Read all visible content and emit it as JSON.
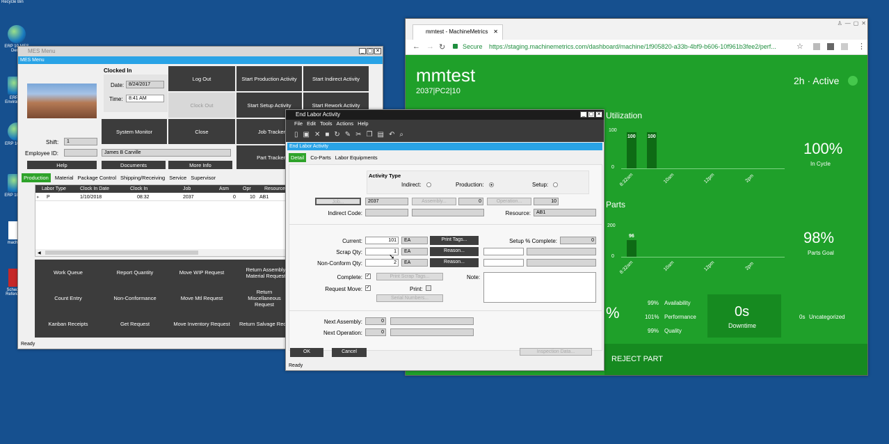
{
  "desktop": {
    "recycle": "Recycle Bin",
    "icon1": "ERP 10 MES Demo",
    "icon2": "ERP 10 Environment",
    "icon3": "ERP 10 EVT",
    "icon4": "ERP 10 MES",
    "icon5": "machine",
    "icon6": "Schedule Reference"
  },
  "mes": {
    "title": "MES Menu",
    "header": "MES Menu",
    "clocked_in": "Clocked In",
    "date_label": "Date:",
    "date": "8/24/2017",
    "time_label": "Time:",
    "time": "8:41 AM",
    "shift_label": "Shift:",
    "shift": "1",
    "emp_label": "Employee ID:",
    "emp_name": "James B Carville",
    "btn": {
      "help": "Help",
      "documents": "Documents",
      "more_info": "More Info",
      "log_out": "Log Out",
      "clock_out": "Clock Out",
      "close": "Close",
      "system_monitor": "System Monitor",
      "start_production": "Start Production Activity",
      "start_indirect": "Start Indirect Activity",
      "start_setup": "Start Setup Activity",
      "start_rework": "Start Rework Activity",
      "job_tracker": "Job Tracker",
      "part_tracker": "Part Tracker"
    },
    "tabs": [
      "Production",
      "Material",
      "Package Control",
      "Shipping/Receiving",
      "Service",
      "Supervisor"
    ],
    "cols": [
      "Labor Type",
      "Clock In Date",
      "Clock In",
      "Job",
      "Asm",
      "Opr",
      "Resource"
    ],
    "row": [
      "P",
      "1/10/2018",
      "08:32",
      "2037",
      "0",
      "10",
      "AB1"
    ],
    "grid": [
      "Work Queue",
      "Report Quantity",
      "Move WIP Request",
      "Return Assembly Material Request",
      "Count Entry",
      "Non-Conformance",
      "Move Mtl Request",
      "Return Miscellaneous Request",
      "Kanban Receipts",
      "Get Request",
      "Move Inventory Request",
      "Return Salvage Request"
    ],
    "status": "Ready"
  },
  "ela": {
    "title": "End Labor Activity",
    "menu": [
      "File",
      "Edit",
      "Tools",
      "Actions",
      "Help"
    ],
    "header": "End Labor Activity",
    "tabs": [
      "Detail",
      "Co-Parts",
      "Labor Equipments"
    ],
    "activity_type": "Activity Type",
    "indirect": "Indirect:",
    "production": "Production:",
    "setup": "Setup:",
    "job_btn": "Job...",
    "job": "2037",
    "assembly_btn": "Assembly...",
    "assembly": "0",
    "operation_btn": "Operation...",
    "operation": "10",
    "indirect_code": "Indirect Code:",
    "resource_label": "Resource:",
    "resource": "AB1",
    "current_label": "Current:",
    "current": "101",
    "uom": "EA",
    "print_tags": "Print Tags...",
    "setup_pct_label": "Setup % Complete:",
    "setup_pct": "0",
    "scrap_label": "Scrap Qty:",
    "scrap": "1",
    "reason": "Reason...",
    "nonconf_label": "Non-Conform Qty:",
    "nonconf": "2",
    "complete_label": "Complete:",
    "print_scrap": "Print Scrap Tags...",
    "note_label": "Note:",
    "request_move_label": "Request Move:",
    "print_label": "Print:",
    "serial": "Serial Numbers...",
    "next_asm_label": "Next Assembly:",
    "next_asm": "0",
    "next_op_label": "Next Operation:",
    "next_op": "0",
    "ok": "OK",
    "cancel": "Cancel",
    "inspection": "Inspection Data...",
    "status": "Ready"
  },
  "browser": {
    "tab": "mmtest - MachineMetrics",
    "secure": "Secure",
    "url": "https://staging.machinemetrics.com/dashboard/machine/1f905820-a33b-4bf9-b606-10f961b3fee2/perf...",
    "machine": "mmtest",
    "sub": "2037|PC2|10",
    "active": "2h · Active",
    "utilization": "Utilization",
    "parts": "Parts",
    "util_y": [
      "100",
      "0"
    ],
    "util_bars": [
      "100",
      "100"
    ],
    "parts_y": [
      "200",
      "0"
    ],
    "parts_bar": "96",
    "x_ticks": [
      "8:32am",
      "10am",
      "12pm",
      "2pm"
    ],
    "in_cycle": "100%",
    "in_cycle_label": "In Cycle",
    "parts_goal": "98%",
    "parts_goal_label": "Parts Goal",
    "oee": "%",
    "avail": "99%",
    "avail_label": "Availability",
    "perf": "101%",
    "perf_label": "Performance",
    "qual": "99%",
    "qual_label": "Quality",
    "downtime": "0s",
    "downtime_label": "Downtime",
    "uncat": "0s",
    "uncat_label": "Uncategorized",
    "reject": "REJECT PART"
  }
}
